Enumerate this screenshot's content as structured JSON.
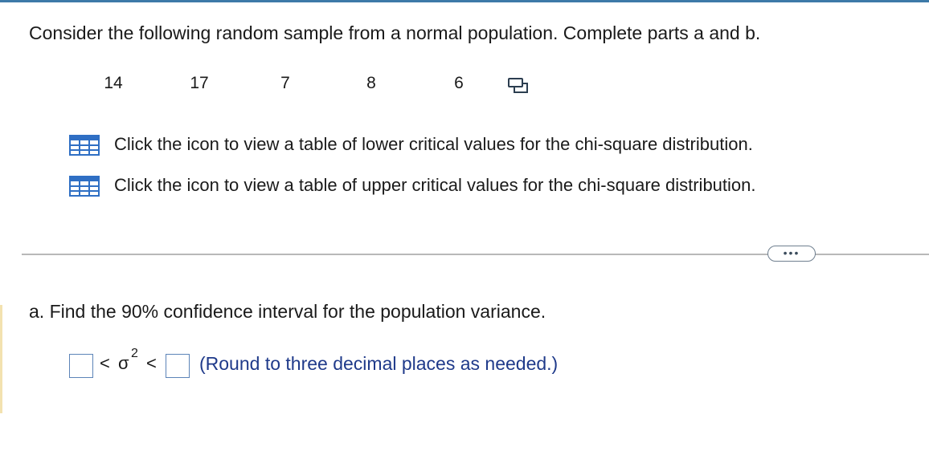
{
  "question": {
    "prompt": "Consider the following random sample from a normal population. Complete parts a and b."
  },
  "sample": {
    "values": [
      "14",
      "17",
      "7",
      "8",
      "6"
    ],
    "copy_icon": "copy-data-icon"
  },
  "table_links": {
    "lower": "Click the icon to view a table of lower critical values for the chi-square distribution.",
    "upper": "Click the icon to view a table of upper critical values for the chi-square distribution.",
    "icon": "table-grid-icon"
  },
  "more_button": {
    "label": "•••"
  },
  "part_a": {
    "question": "a. Find the 90% confidence interval for the population variance.",
    "less_than_1": "<",
    "variance_symbol": "σ",
    "exponent": "2",
    "less_than_2": "<",
    "lower_bound_value": "",
    "upper_bound_value": "",
    "hint": "(Round to three decimal places as needed.)"
  },
  "colors": {
    "top_rule": "#3d7aa8",
    "hint_text": "#1f3a8a",
    "input_border": "#5c84b8",
    "grid_icon": "#2f6fc4"
  }
}
